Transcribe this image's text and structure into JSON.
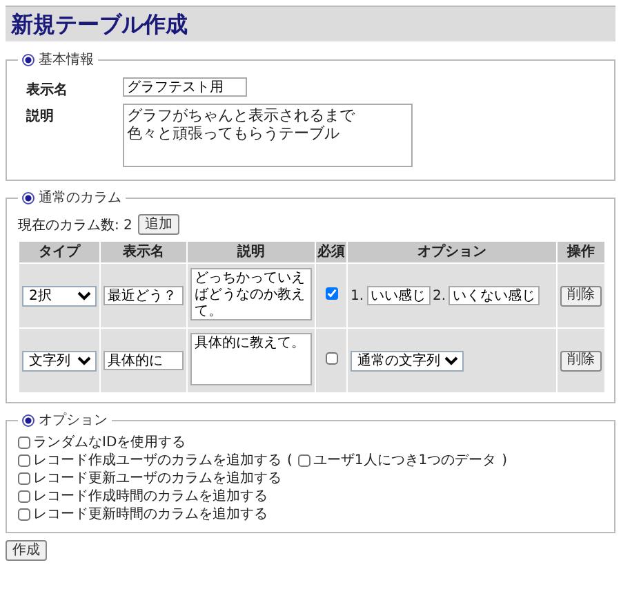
{
  "page_title": "新規テーブル作成",
  "basic_info": {
    "legend": "基本情報",
    "display_name": {
      "label": "表示名",
      "value": "グラフテスト用"
    },
    "description": {
      "label": "説明",
      "lines": [
        "グラフがちゃんと表示されるまで",
        "色々と頑張ってもらうテーブル"
      ]
    }
  },
  "columns_section": {
    "legend": "通常のカラム",
    "count_label": "現在のカラム数: 2",
    "add_button": "追加",
    "table": {
      "columns": [
        "タイプ",
        "表示名",
        "説明",
        "必須",
        "オプション",
        "操作"
      ],
      "rows": [
        {
          "kind": "choice",
          "type": "2択",
          "name": "最近どう？",
          "description": "どっちかっていえばどうなのか教えて。",
          "required": true,
          "options": [
            {
              "number": "1.",
              "value": "いい感じ"
            },
            {
              "number": "2.",
              "value": "いくない感じ"
            }
          ],
          "action": "削除"
        },
        {
          "kind": "select",
          "type": "文字列",
          "name": "具体的に",
          "description": "具体的に教えて。",
          "required": false,
          "option_select": "通常の文字列",
          "action": "削除"
        }
      ]
    }
  },
  "options_section": {
    "legend": "オプション",
    "items": [
      {
        "label": "ランダムなIDを使用する",
        "checked": false
      },
      {
        "label": "レコード作成ユーザのカラムを追加する",
        "checked": false,
        "sub": {
          "before": "(",
          "label": "ユーザ1人につき1つのデータ",
          "after": ")",
          "checked": false
        }
      },
      {
        "label": "レコード更新ユーザのカラムを追加する",
        "checked": false
      },
      {
        "label": "レコード作成時間のカラムを追加する",
        "checked": false
      },
      {
        "label": "レコード更新時間のカラムを追加する",
        "checked": false
      }
    ]
  },
  "submit_button": "作成"
}
